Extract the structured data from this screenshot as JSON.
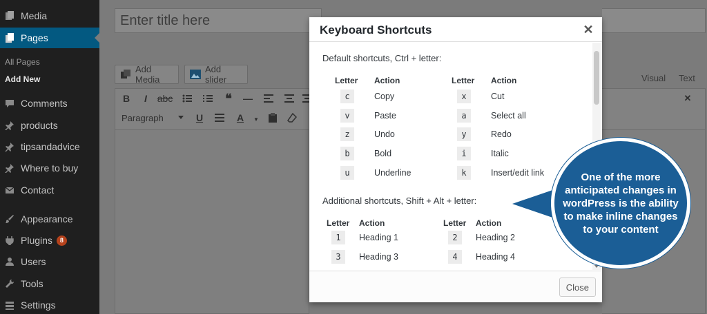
{
  "sidebar": {
    "items": [
      {
        "label": "Media",
        "icon": "media-icon",
        "active": false
      },
      {
        "label": "Pages",
        "icon": "pages-icon",
        "active": true
      },
      {
        "label": "Comments",
        "icon": "comments-icon",
        "active": false
      },
      {
        "label": "products",
        "icon": "pin-icon",
        "active": false
      },
      {
        "label": "tipsandadvice",
        "icon": "pin-icon",
        "active": false
      },
      {
        "label": "Where to buy",
        "icon": "pin-icon",
        "active": false
      },
      {
        "label": "Contact",
        "icon": "mail-icon",
        "active": false
      },
      {
        "label": "Appearance",
        "icon": "brush-icon",
        "active": false
      },
      {
        "label": "Plugins",
        "icon": "plug-icon",
        "active": false,
        "badge": "8"
      },
      {
        "label": "Users",
        "icon": "user-icon",
        "active": false
      },
      {
        "label": "Tools",
        "icon": "wrench-icon",
        "active": false
      },
      {
        "label": "Settings",
        "icon": "settings-icon",
        "active": false
      }
    ],
    "submenu": {
      "all_pages": "All Pages",
      "add_new": "Add New"
    }
  },
  "editor": {
    "title_placeholder": "Enter title here",
    "add_media": "Add Media",
    "add_slider": "Add slider",
    "tab_visual": "Visual",
    "tab_text": "Text",
    "format": "Paragraph"
  },
  "modal": {
    "title": "Keyboard Shortcuts",
    "default_title": "Default shortcuts, Ctrl + letter:",
    "additional_title": "Additional shortcuts, Shift + Alt + letter:",
    "col_letter": "Letter",
    "col_action": "Action",
    "default_shortcuts": [
      {
        "key": "c",
        "action": "Copy",
        "key2": "x",
        "action2": "Cut"
      },
      {
        "key": "v",
        "action": "Paste",
        "key2": "a",
        "action2": "Select all"
      },
      {
        "key": "z",
        "action": "Undo",
        "key2": "y",
        "action2": "Redo"
      },
      {
        "key": "b",
        "action": "Bold",
        "key2": "i",
        "action2": "Italic"
      },
      {
        "key": "u",
        "action": "Underline",
        "key2": "k",
        "action2": "Insert/edit link"
      }
    ],
    "additional_shortcuts": [
      {
        "key": "1",
        "action": "Heading 1",
        "key2": "2",
        "action2": "Heading 2"
      },
      {
        "key": "3",
        "action": "Heading 3",
        "key2": "4",
        "action2": "Heading 4"
      }
    ],
    "close_label": "Close"
  },
  "callout": {
    "text": "One of the more anticipated changes in wordPress is the ability to make inline changes to your content",
    "color": "#1b5e96"
  },
  "colors": {
    "sidebar_bg": "#1f1f1f",
    "active_bg": "#035981",
    "overlay": "#7b7b7b"
  }
}
